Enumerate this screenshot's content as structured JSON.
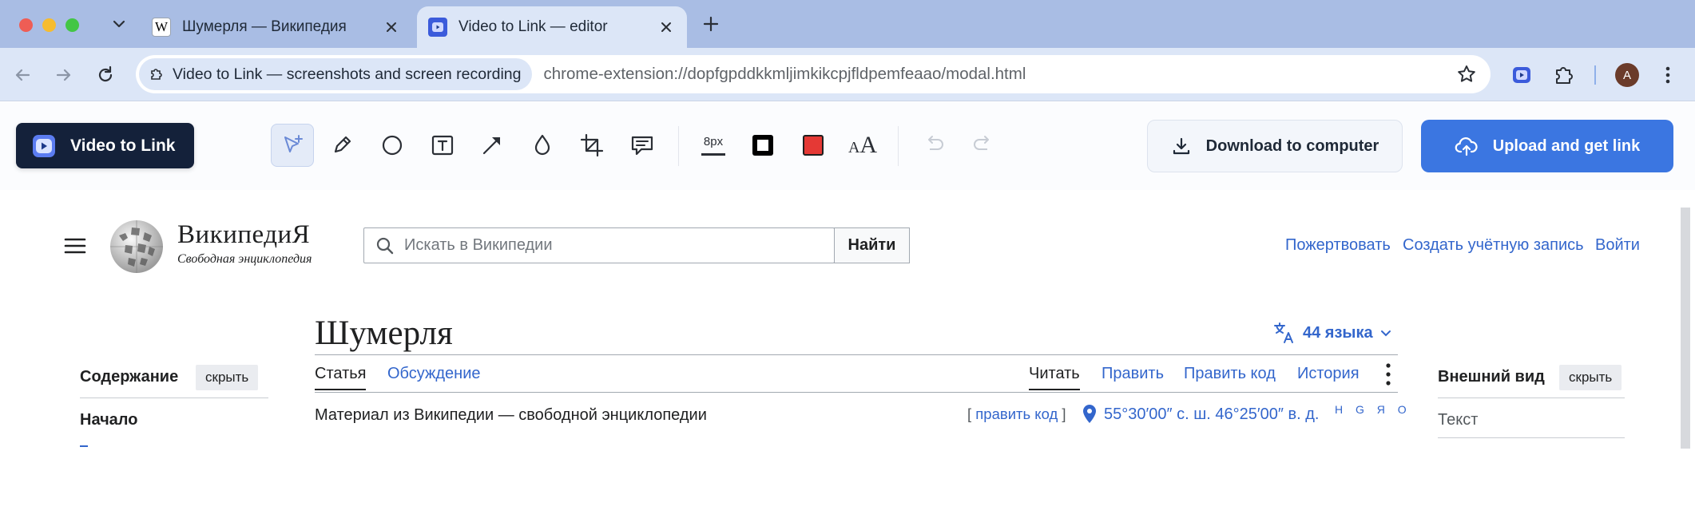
{
  "browser": {
    "tabs": [
      {
        "title": "Шумерля — Википедия",
        "favicon": "wikipedia-w-icon",
        "active": false
      },
      {
        "title": "Video to Link — editor",
        "favicon": "video-to-link-icon",
        "active": true
      }
    ],
    "chip_label": "Video to Link — screenshots and screen recording",
    "url": "chrome-extension://dopfgpddkkmljimkikcpjfldpemfeaao/modal.html",
    "profile_initial": "A",
    "colors": {
      "tabbar": "#a9bde4",
      "toolbar": "#dce6f7"
    }
  },
  "editor": {
    "brand_label": "Video to Link",
    "tools": [
      "select-tool",
      "pen-tool",
      "ellipse-tool",
      "text-tool",
      "arrow-tool",
      "blur-tool",
      "crop-tool",
      "comment-tool"
    ],
    "stroke_width": "8px",
    "text_tool_glyph": "A",
    "text_size_glyph": "AA",
    "download_label": "Download to computer",
    "upload_label": "Upload and get link",
    "colors": {
      "accent": "#3b76e1",
      "brand_bg": "#14213a",
      "fill": "#e53935"
    }
  },
  "wiki": {
    "wordmark": "ВикипедиЯ",
    "tagline": "Свободная энциклопедия",
    "search_placeholder": "Искать в Википедии",
    "search_button": "Найти",
    "top_links": [
      "Пожертвовать",
      "Создать учётную запись",
      "Войти"
    ],
    "title": "Шумерля",
    "languages": "44 языка",
    "tabs_left": [
      "Статья",
      "Обсуждение"
    ],
    "tabs_right": [
      "Читать",
      "Править",
      "Править код",
      "История"
    ],
    "subtitle": "Материал из Википедии — свободной энциклопедии",
    "edit_code": {
      "open": "[",
      "label": "править код",
      "close": "]"
    },
    "coordinates": "55°30′00″ с. ш. 46°25′00″ в. д.",
    "map_links": "H G Я O",
    "toc_heading": "Содержание",
    "toc_hide": "скрыть",
    "toc_start": "Начало",
    "appearance_heading": "Внешний вид",
    "appearance_hide": "скрыть",
    "appearance_text": "Текст",
    "colors": {
      "link": "#3366cc",
      "text": "#202122"
    }
  }
}
